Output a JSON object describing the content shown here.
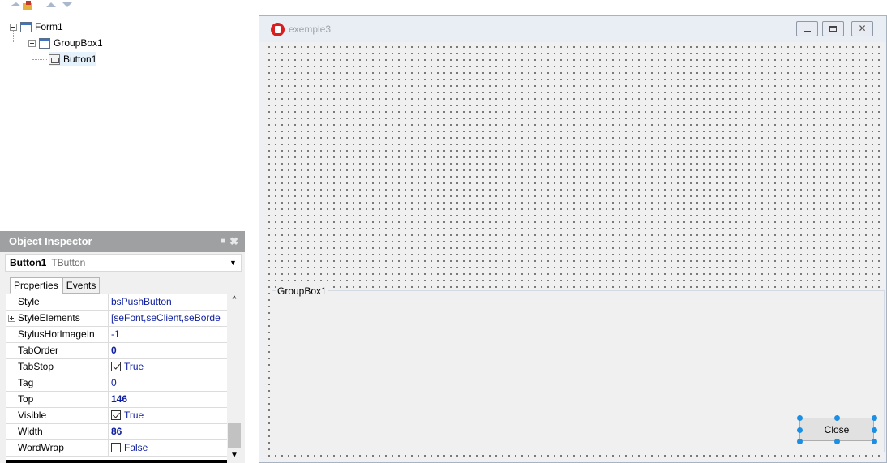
{
  "structure": {
    "nodes": [
      {
        "label": "Form1",
        "icon": "form-icon"
      },
      {
        "label": "GroupBox1",
        "icon": "groupbox-icon"
      },
      {
        "label": "Button1",
        "icon": "button-icon"
      }
    ]
  },
  "inspector": {
    "title": "Object Inspector",
    "selected_object": "Button1",
    "selected_class": "TButton",
    "tabs": [
      "Properties",
      "Events"
    ],
    "active_tab": "Properties",
    "properties": [
      {
        "name": "Style",
        "value": "bsPushButton",
        "kind": "text"
      },
      {
        "name": "StyleElements",
        "value": "[seFont,seClient,seBorde",
        "kind": "text",
        "expandable": true
      },
      {
        "name": "StylusHotImageIn",
        "value": "-1",
        "kind": "text"
      },
      {
        "name": "TabOrder",
        "value": "0",
        "kind": "bold"
      },
      {
        "name": "TabStop",
        "value": "True",
        "kind": "checkbox",
        "checked": true
      },
      {
        "name": "Tag",
        "value": "0",
        "kind": "text"
      },
      {
        "name": "Top",
        "value": "146",
        "kind": "bold"
      },
      {
        "name": "Visible",
        "value": "True",
        "kind": "checkbox",
        "checked": true
      },
      {
        "name": "Width",
        "value": "86",
        "kind": "bold"
      },
      {
        "name": "WordWrap",
        "value": "False",
        "kind": "checkbox",
        "checked": false
      }
    ]
  },
  "form": {
    "title": "exemple3",
    "groupbox_caption": "GroupBox1",
    "button_caption": "Close"
  },
  "colors": {
    "selection_handle": "#1a8fe6",
    "inspector_title_bg": "#9ea0a2",
    "property_value": "#1020a0"
  }
}
